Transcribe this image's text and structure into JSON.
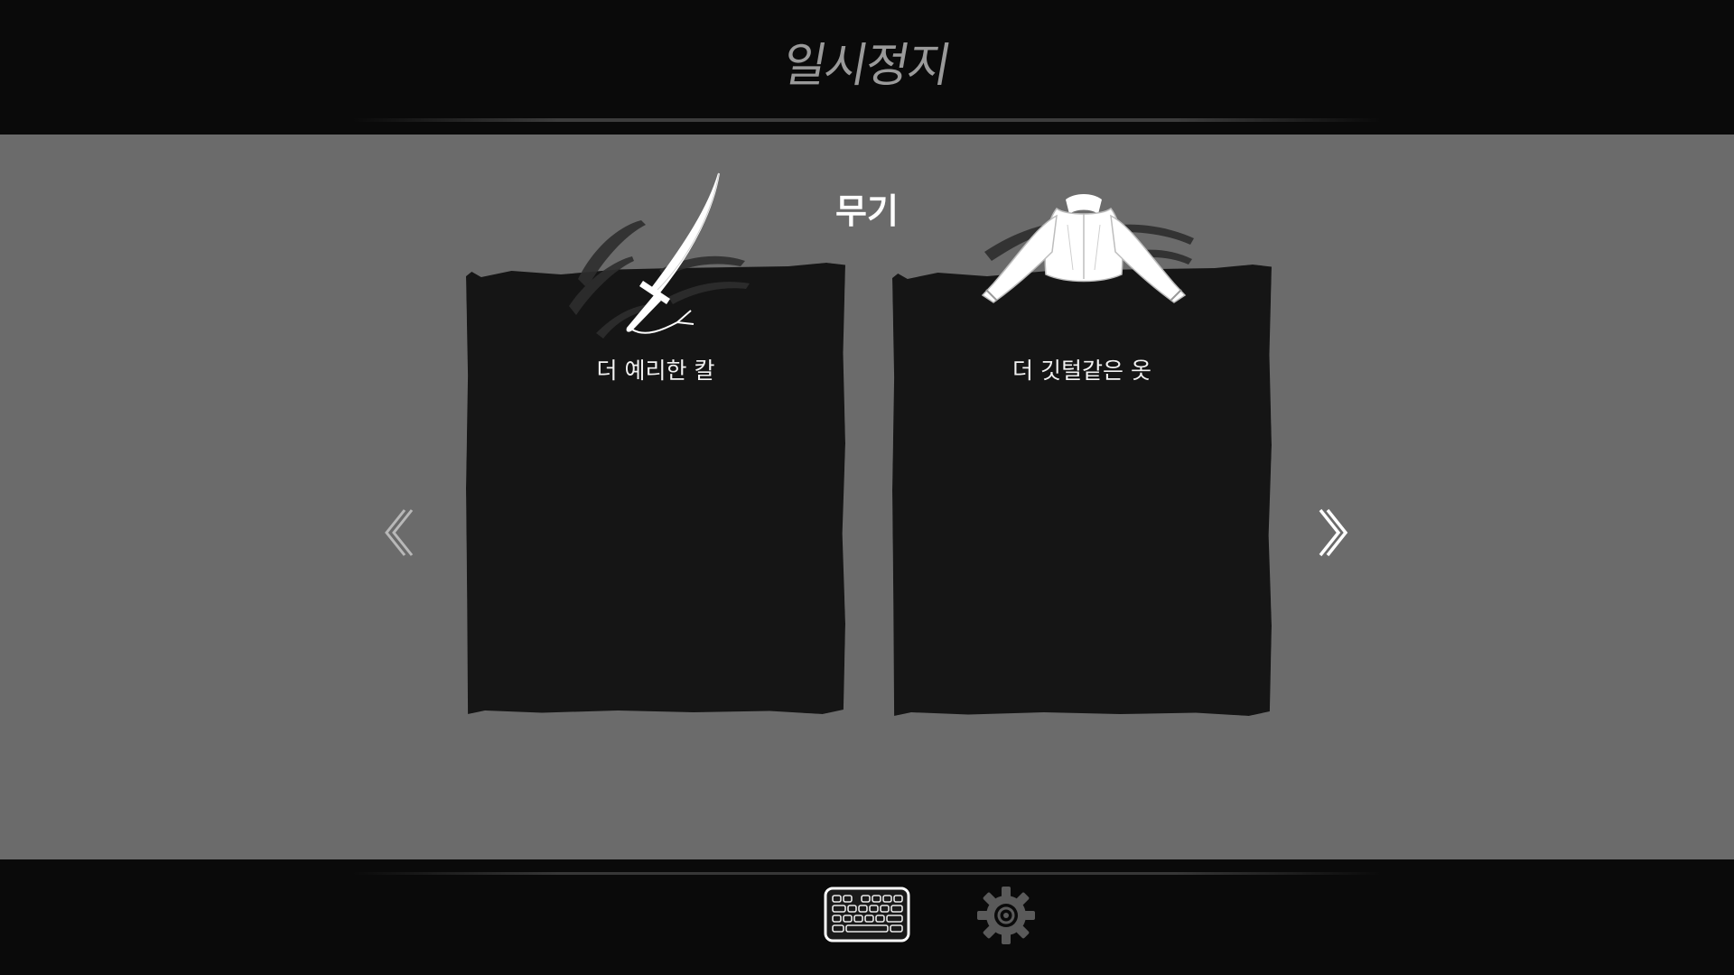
{
  "header": {
    "title": "일시정지"
  },
  "main": {
    "section_title": "무기",
    "cards": [
      {
        "label": "더 예리한 칼",
        "icon": "sword-icon"
      },
      {
        "label": "더 깃털같은 옷",
        "icon": "coat-icon"
      }
    ],
    "nav": {
      "left_icon": "chevron-left-icon",
      "right_icon": "chevron-right-icon"
    }
  },
  "footer": {
    "tabs": [
      {
        "icon": "keyboard-icon",
        "selected": true
      },
      {
        "icon": "gear-icon",
        "selected": false
      }
    ]
  },
  "colors": {
    "background": "#0a0a0a",
    "panel": "#6b6b6b",
    "card": "#151515",
    "title": "#9a9a9a",
    "text": "#ffffff"
  }
}
